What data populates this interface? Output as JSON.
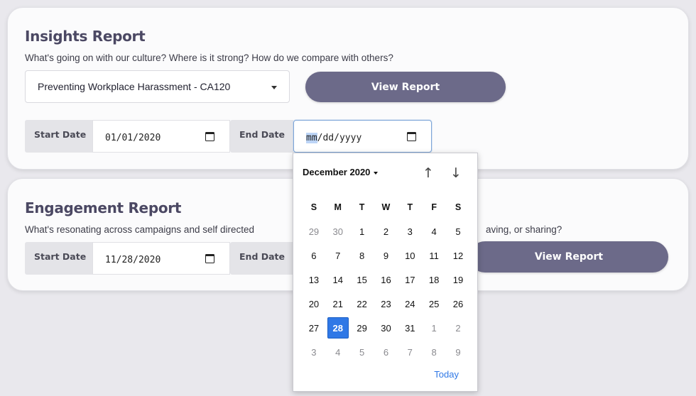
{
  "insights": {
    "title": "Insights Report",
    "description": "What's going on with our culture? Where is it strong? How do we compare with others?",
    "course_select": {
      "value": "Preventing Workplace Harassment - CA120"
    },
    "view_button": "View Report",
    "start_label": "Start Date",
    "start_value": "01/01/2020",
    "end_label": "End Date",
    "end_mm": "mm",
    "end_rest": "/dd/yyyy"
  },
  "engagement": {
    "title": "Engagement Report",
    "description_left": "What's resonating across campaigns and self directed",
    "description_right": "aving, or sharing?",
    "start_label": "Start Date",
    "start_value": "11/28/2020",
    "end_label": "End Date",
    "view_button": "View Report"
  },
  "calendar": {
    "month_label": "December 2020",
    "weekday_headers": [
      "S",
      "M",
      "T",
      "W",
      "T",
      "F",
      "S"
    ],
    "weeks": [
      [
        {
          "d": "29",
          "m": true
        },
        {
          "d": "30",
          "m": true
        },
        {
          "d": "1"
        },
        {
          "d": "2"
        },
        {
          "d": "3"
        },
        {
          "d": "4"
        },
        {
          "d": "5"
        }
      ],
      [
        {
          "d": "6"
        },
        {
          "d": "7"
        },
        {
          "d": "8"
        },
        {
          "d": "9"
        },
        {
          "d": "10"
        },
        {
          "d": "11"
        },
        {
          "d": "12"
        }
      ],
      [
        {
          "d": "13"
        },
        {
          "d": "14"
        },
        {
          "d": "15"
        },
        {
          "d": "16"
        },
        {
          "d": "17"
        },
        {
          "d": "18"
        },
        {
          "d": "19"
        }
      ],
      [
        {
          "d": "20"
        },
        {
          "d": "21"
        },
        {
          "d": "22"
        },
        {
          "d": "23"
        },
        {
          "d": "24"
        },
        {
          "d": "25"
        },
        {
          "d": "26"
        }
      ],
      [
        {
          "d": "27"
        },
        {
          "d": "28",
          "sel": true
        },
        {
          "d": "29"
        },
        {
          "d": "30"
        },
        {
          "d": "31"
        },
        {
          "d": "1",
          "m": true
        },
        {
          "d": "2",
          "m": true
        }
      ],
      [
        {
          "d": "3",
          "m": true
        },
        {
          "d": "4",
          "m": true
        },
        {
          "d": "5",
          "m": true
        },
        {
          "d": "6",
          "m": true
        },
        {
          "d": "7",
          "m": true
        },
        {
          "d": "8",
          "m": true
        },
        {
          "d": "9",
          "m": true
        }
      ]
    ],
    "today_label": "Today"
  },
  "colors": {
    "background": "#e9e8ed",
    "button": "#6c6a89",
    "title": "#4b4863",
    "selected_day": "#2f78e6"
  },
  "icons": [
    "calendar-icon",
    "dropdown-caret-icon",
    "arrow-up-icon",
    "arrow-down-icon"
  ]
}
